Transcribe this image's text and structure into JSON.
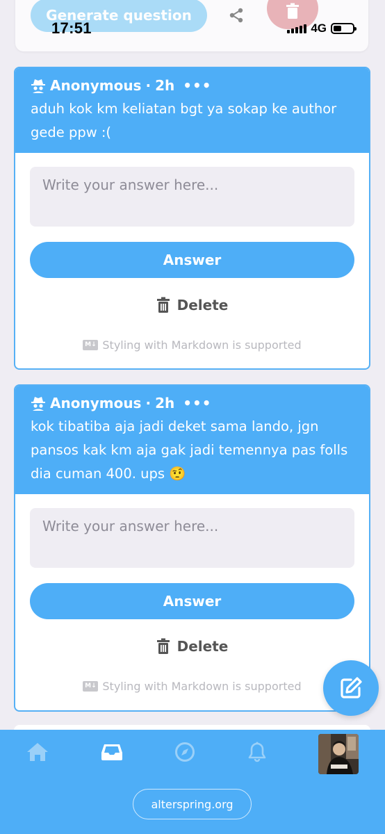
{
  "status_bar": {
    "time": "17:51",
    "network": "4G"
  },
  "top_card": {
    "generate_label": "Generate question"
  },
  "questions": [
    {
      "author": "Anonymous",
      "separator": "·",
      "time_ago": "2h",
      "text": "aduh kok km keliatan bgt ya sokap ke author gede ppw :(",
      "answer_placeholder": "Write your answer here...",
      "answer_label": "Answer",
      "delete_label": "Delete",
      "markdown_note": "Styling with Markdown is supported"
    },
    {
      "author": "Anonymous",
      "separator": "·",
      "time_ago": "2h",
      "text": "kok tibatiba aja jadi deket sama lando, jgn pansos kak km aja gak jadi temennya pas folls dia cuman 400. ups 🤨",
      "answer_placeholder": "Write your answer here...",
      "answer_label": "Answer",
      "delete_label": "Delete",
      "markdown_note": "Styling with Markdown is supported"
    }
  ],
  "bottom_nav": {
    "items": [
      "home-icon",
      "inbox-icon",
      "compass-icon",
      "bell-icon",
      "avatar"
    ],
    "active": "inbox-icon"
  },
  "footer": {
    "site": "alterspring.org"
  },
  "colors": {
    "accent": "#4eaef7",
    "background": "#efedf3",
    "delete": "#e8b3b8"
  }
}
